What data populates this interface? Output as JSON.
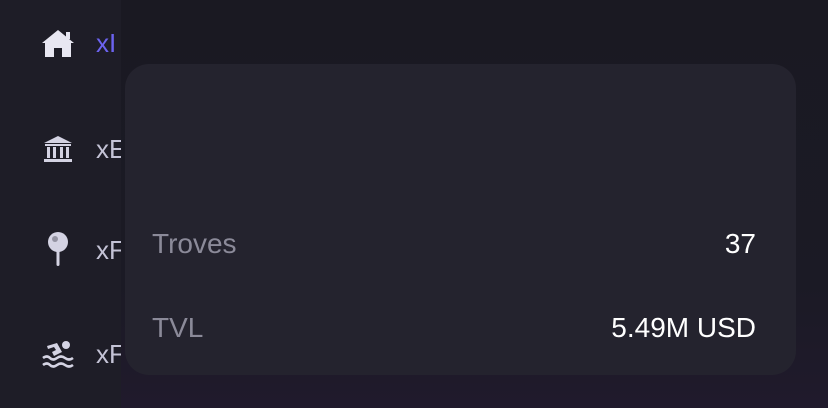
{
  "sidebar": {
    "items": [
      {
        "icon": "home-icon",
        "label": "xI"
      },
      {
        "icon": "bank-icon",
        "label": "xE"
      },
      {
        "icon": "pin-icon",
        "label": "xF"
      },
      {
        "icon": "swimmer-icon",
        "label": "xF"
      }
    ]
  },
  "stats": {
    "troves_label": "Troves",
    "troves_value": "37",
    "tvl_label": "TVL",
    "tvl_value": "5.49M USD"
  },
  "colors": {
    "accent": "#6c63f0",
    "icon": "#d4d3e3",
    "background": "#1c1b24",
    "card": "#24232e"
  }
}
